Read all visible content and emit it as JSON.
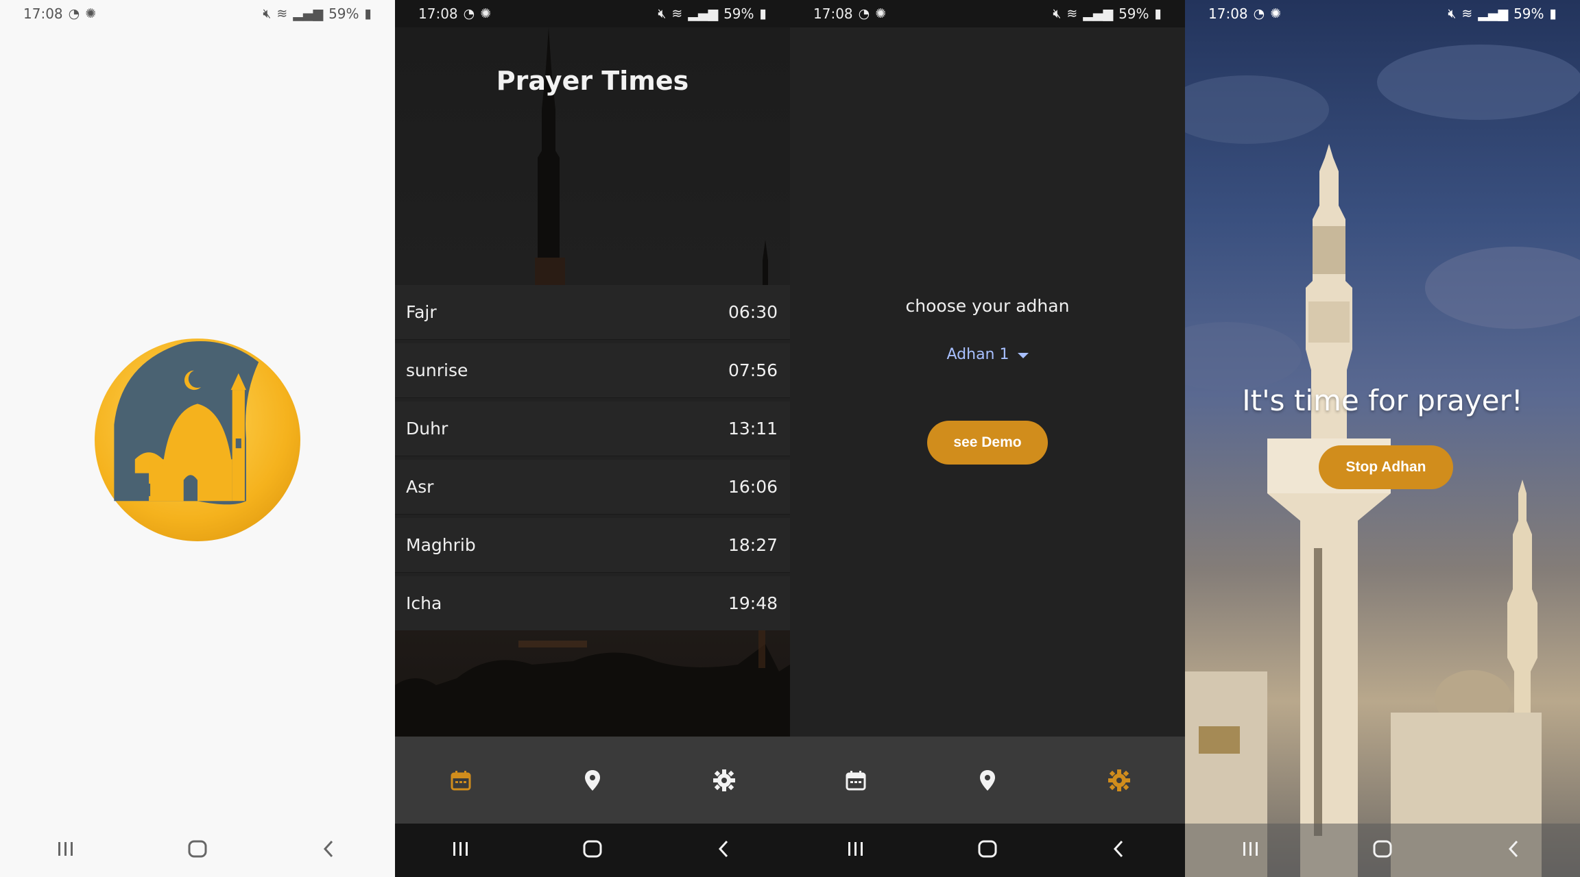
{
  "status_bar": {
    "time": "17:08",
    "battery": "59%",
    "left_icons": [
      "whatsapp-icon",
      "settings-gear-icon"
    ],
    "right_icons": [
      "mute-icon",
      "wifi-icon",
      "signal-icon",
      "battery-icon"
    ]
  },
  "screen2": {
    "title": "Prayer Times",
    "prayers": [
      {
        "name": "Fajr",
        "time": "06:30"
      },
      {
        "name": "sunrise",
        "time": "07:56"
      },
      {
        "name": "Duhr",
        "time": "13:11"
      },
      {
        "name": "Asr",
        "time": "16:06"
      },
      {
        "name": "Maghrib",
        "time": "18:27"
      },
      {
        "name": "Icha",
        "time": "19:48"
      }
    ]
  },
  "screen3": {
    "choose_label": "choose your adhan",
    "selected_adhan": "Adhan 1",
    "demo_button": "see Demo"
  },
  "screen4": {
    "message": "It's time for prayer!",
    "stop_button": "Stop Adhan"
  },
  "colors": {
    "accent": "#d18d1c",
    "dropdown_text": "#a8c0ff",
    "dark_bg": "#222222",
    "nav_bg": "#3a3a3a"
  }
}
